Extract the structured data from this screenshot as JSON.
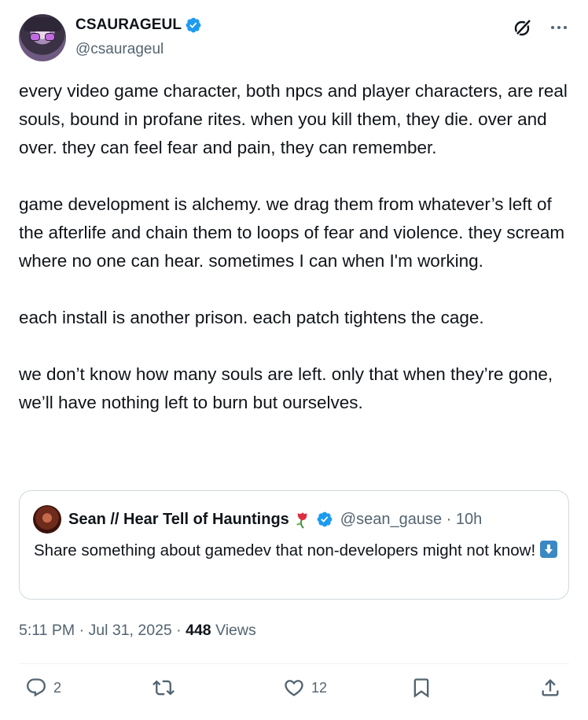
{
  "author": {
    "display_name": "CSAURAGEUL",
    "handle": "@csaurageul"
  },
  "body": {
    "paragraphs": [
      "every video game character, both npcs and player characters, are real souls, bound in profane rites. when you kill them, they die. over and over. they can feel fear and pain, they can remember.",
      "game development is alchemy. we drag them from whatever’s left of the afterlife and chain them to loops of fear and violence. they scream where no one can hear. sometimes I can when I'm working.",
      "each install is another prison. each patch tightens the cage.",
      "we don’t know how many souls are left. only that when they’re gone, we’ll have nothing left to burn but ourselves."
    ]
  },
  "quote": {
    "display_name": "Sean // Hear Tell of Hauntings",
    "handle_time": "@sean_gause · 10h",
    "text": "Share something about gamedev that non-developers might not know!"
  },
  "meta": {
    "timestamp": "5:11 PM · Jul 31, 2025 · ",
    "views_count": "448",
    "views_label": "Views"
  },
  "actions": {
    "replies": "2",
    "likes": "12"
  },
  "colors": {
    "verified": "#1d9bf0",
    "secondary_text": "#536471",
    "primary_text": "#0f1419",
    "border": "#cfd9de"
  },
  "icons": [
    "verified-badge-icon",
    "grok-icon",
    "more-icon",
    "rose-emoji-icon",
    "down-arrow-emoji-icon",
    "reply-icon",
    "retweet-icon",
    "like-icon",
    "bookmark-icon",
    "share-icon"
  ]
}
